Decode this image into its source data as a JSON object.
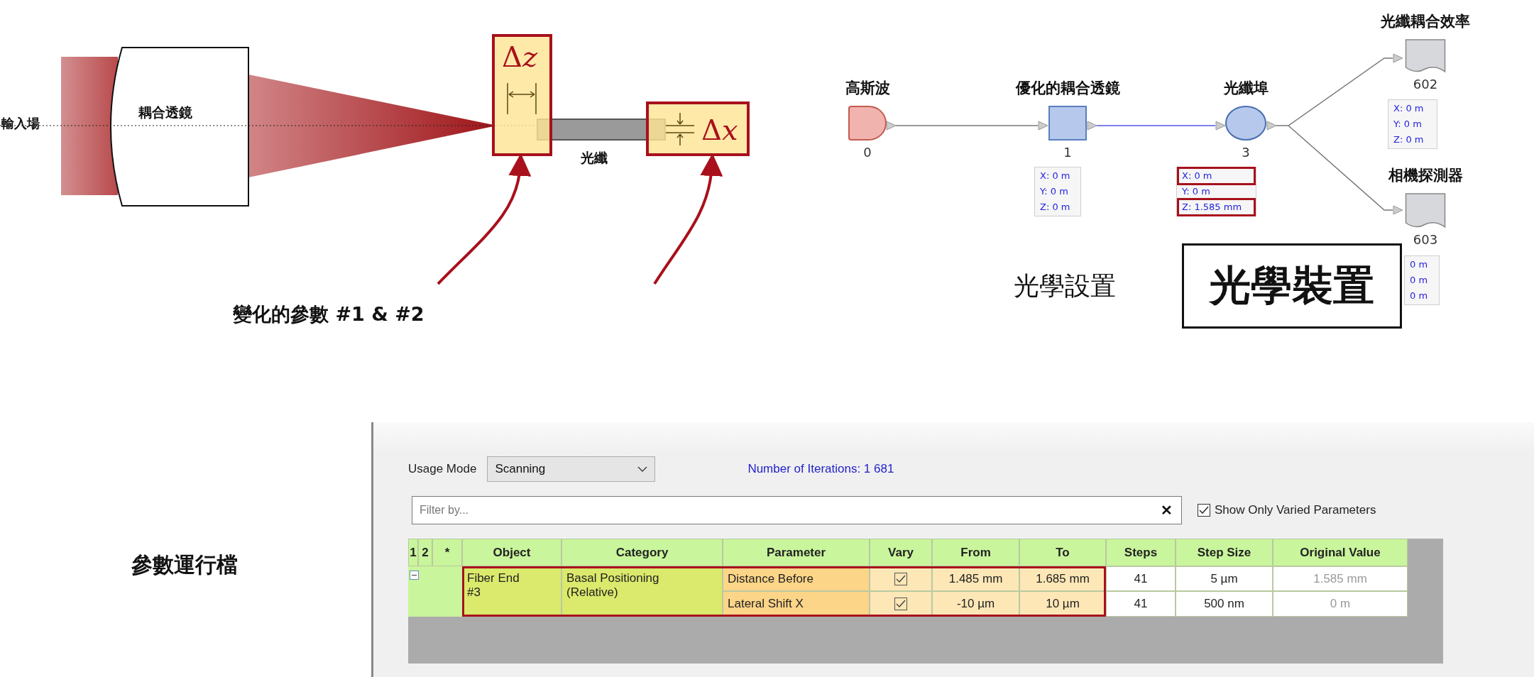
{
  "lens_diagram": {
    "input_label": "輸入場",
    "lens_label": "耦合透鏡",
    "fiber_label": "光纖",
    "delta_z": {
      "symbol": "Δ",
      "variable": "z"
    },
    "delta_x": {
      "symbol": "Δ",
      "variable": "x"
    },
    "caption": "變化的參數 #1 & #2"
  },
  "optical_setup": {
    "nodes": [
      {
        "kind": "source",
        "label": "高斯波",
        "number": "0"
      },
      {
        "kind": "lens",
        "label": "優化的耦合透鏡",
        "number": "1",
        "position": [
          {
            "text": "X: 0 m",
            "highlighted": false
          },
          {
            "text": "Y: 0 m",
            "highlighted": false
          },
          {
            "text": "Z: 0 m",
            "highlighted": false
          }
        ]
      },
      {
        "kind": "port",
        "label": "光纖埠",
        "number": "3",
        "position": [
          {
            "text": "X: 0 m",
            "highlighted": true
          },
          {
            "text": "Y: 0 m",
            "highlighted": false
          },
          {
            "text": "Z: 1.585 mm",
            "highlighted": true
          }
        ]
      },
      {
        "kind": "detector",
        "label": "光纖耦合效率",
        "number": "602",
        "position": [
          {
            "text": "X: 0 m",
            "highlighted": false
          },
          {
            "text": "Y: 0 m",
            "highlighted": false
          },
          {
            "text": "Z: 0 m",
            "highlighted": false
          }
        ]
      },
      {
        "kind": "detector",
        "label": "相機探測器",
        "number": "603",
        "position": [
          {
            "text": "0 m",
            "highlighted": false
          },
          {
            "text": "0 m",
            "highlighted": false
          },
          {
            "text": "0 m",
            "highlighted": false
          }
        ]
      }
    ],
    "caption": "光學設置",
    "stamp": "光學裝置"
  },
  "parameter_run": {
    "title": "參數運行檔",
    "usage_mode_label": "Usage Mode",
    "usage_mode": "Scanning",
    "iterations": "Number of Iterations: 1 681",
    "filter": {
      "placeholder": "Filter by..."
    },
    "clear": "✕",
    "show_only_varied": {
      "label": "Show Only Varied Parameters",
      "checked": true
    },
    "table": {
      "columns": [
        "1",
        "2",
        "*",
        "Object",
        "Category",
        "Parameter",
        "Vary",
        "From",
        "To",
        "Steps",
        "Step Size",
        "Original Value"
      ],
      "groups": [
        {
          "object": "Fiber End #3",
          "category": "Basal Positioning (Relative)",
          "expanded": true,
          "params": [
            {
              "parameter": "Distance Before",
              "vary": true,
              "from": "1.485 mm",
              "to": "1.685 mm",
              "steps": "41",
              "step_size": "5 µm",
              "original": "1.585 mm"
            },
            {
              "parameter": "Lateral Shift X",
              "vary": true,
              "from": "-10 µm",
              "to": "10 µm",
              "steps": "41",
              "step_size": "500 nm",
              "original": "0 m"
            }
          ]
        }
      ]
    }
  }
}
